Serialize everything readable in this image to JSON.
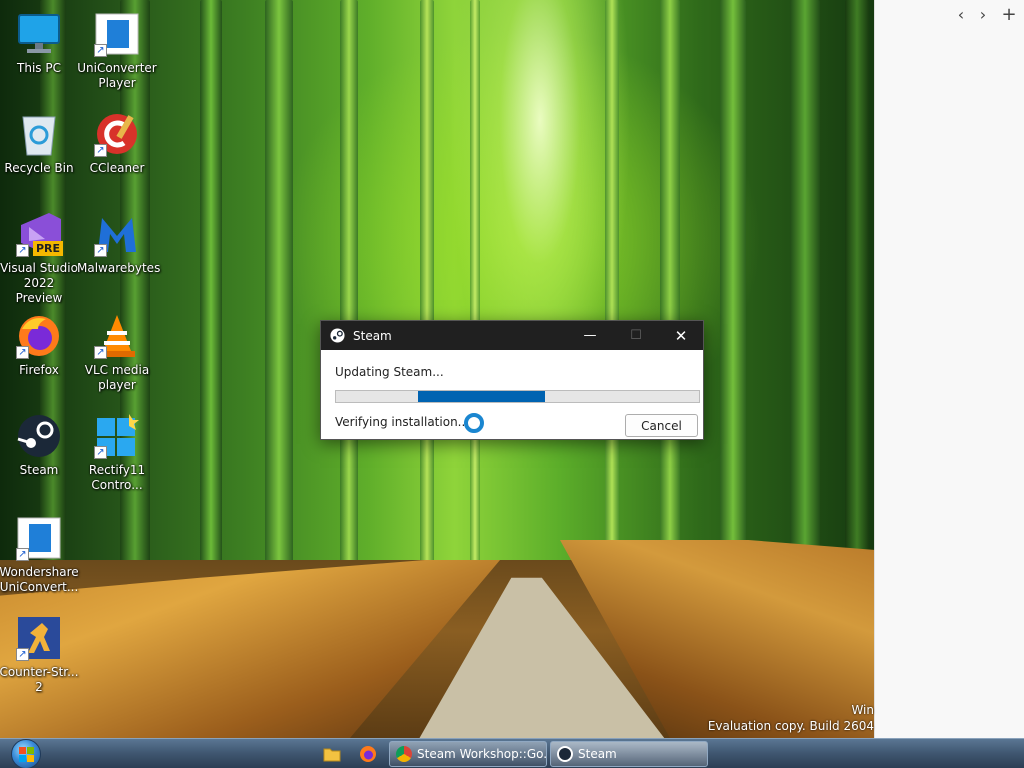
{
  "desktop": {
    "icons": [
      {
        "label": "This PC"
      },
      {
        "label": "UniConverter Player"
      },
      {
        "label": "Recycle Bin"
      },
      {
        "label": "CCleaner"
      },
      {
        "label": "Visual Studio 2022 Preview"
      },
      {
        "label": "Malwarebytes"
      },
      {
        "label": "Firefox"
      },
      {
        "label": "VLC media player"
      },
      {
        "label": "Steam"
      },
      {
        "label": "Rectify11 Contro..."
      },
      {
        "label": "Wondershare UniConvert..."
      },
      {
        "label": "Counter-Str... 2"
      }
    ],
    "vs_badge": "PRE"
  },
  "watermark": {
    "line1": "Win",
    "line2": "Evaluation copy. Build 2604"
  },
  "side_pane": {
    "back": "‹",
    "forward": "›",
    "add": "+"
  },
  "steam_dialog": {
    "title": "Steam",
    "status": "Updating Steam...",
    "progress_start": 0.225,
    "progress_end": 0.575,
    "substatus": "Verifying installation...",
    "cancel_label": "Cancel",
    "minimize": "—",
    "maximize": "☐",
    "close": "✕"
  },
  "taskbar": {
    "tasks": [
      {
        "label": "Steam Workshop::Go..."
      },
      {
        "label": "Steam"
      }
    ]
  },
  "colors": {
    "progress": "#0063b1",
    "titlebar": "#202020"
  }
}
